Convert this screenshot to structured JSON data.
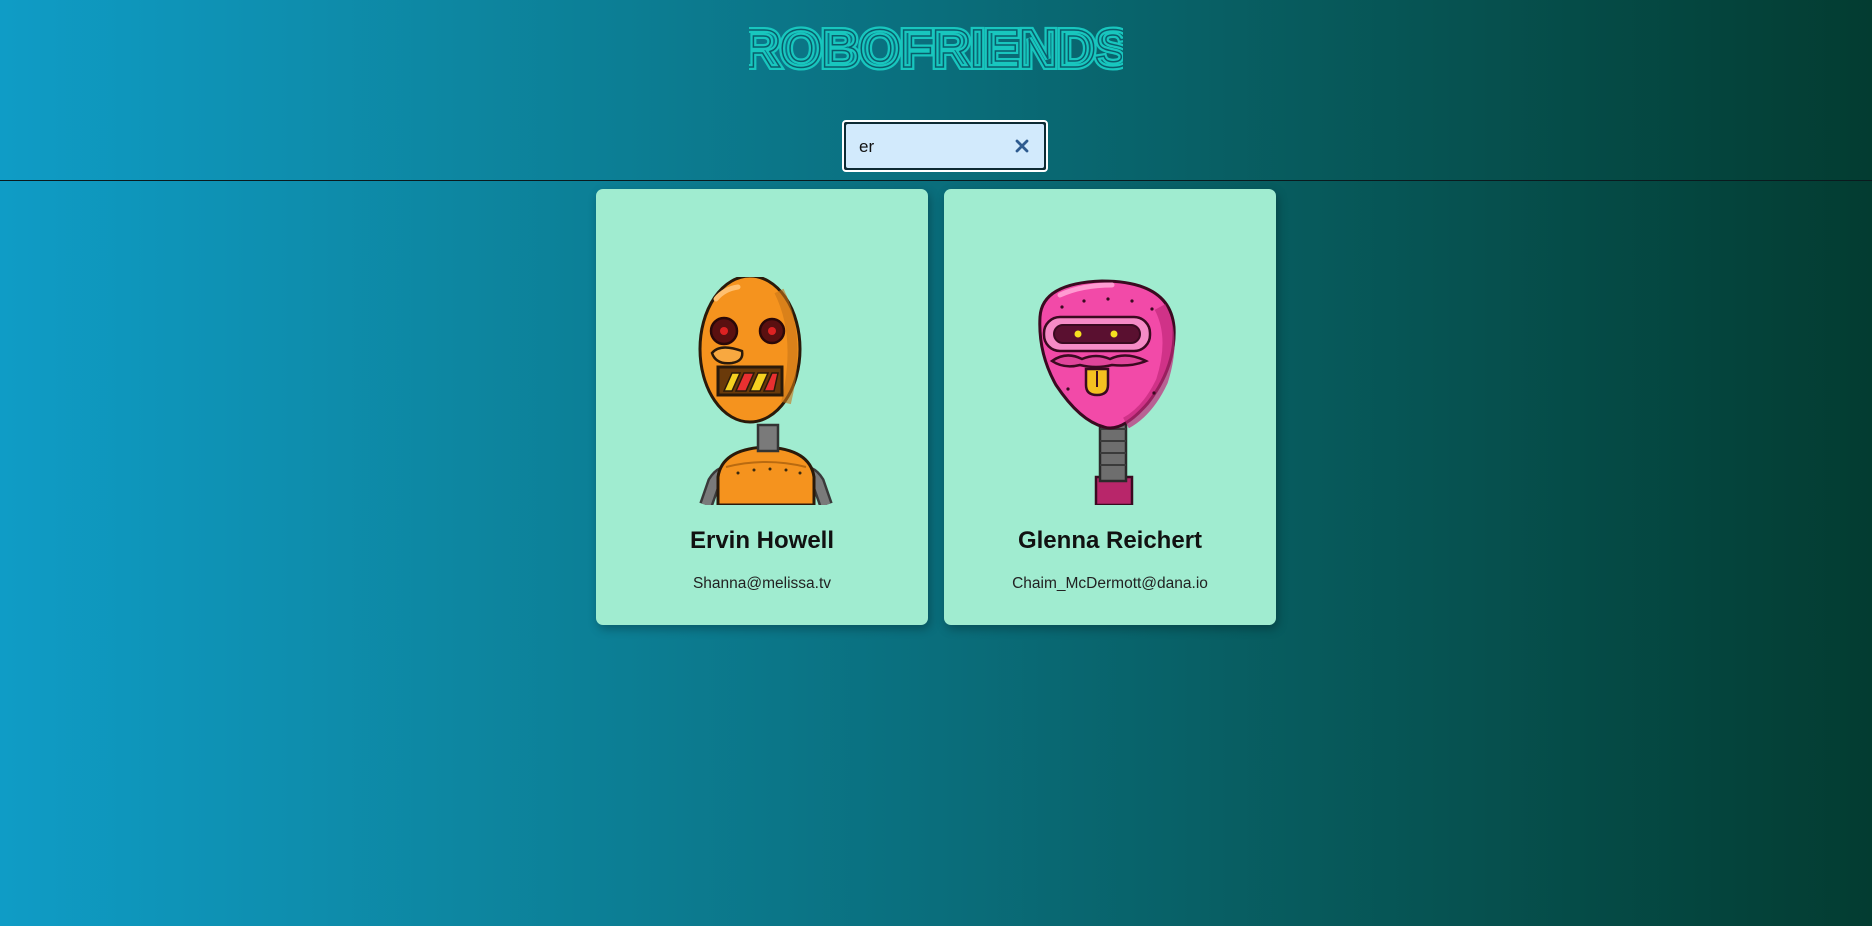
{
  "app": {
    "title": "ROBOFRIENDS",
    "title_color": "#18c6be"
  },
  "search": {
    "value": "er",
    "placeholder": "search robots",
    "clear_icon": "close-icon"
  },
  "robots": [
    {
      "name": "Ervin Howell",
      "email": "Shanna@melissa.tv",
      "color": "orange"
    },
    {
      "name": "Glenna Reichert",
      "email": "Chaim_McDermott@dana.io",
      "color": "pink"
    }
  ],
  "colors": {
    "card_background": "#a0ecd0",
    "search_background": "#d2eafc"
  }
}
